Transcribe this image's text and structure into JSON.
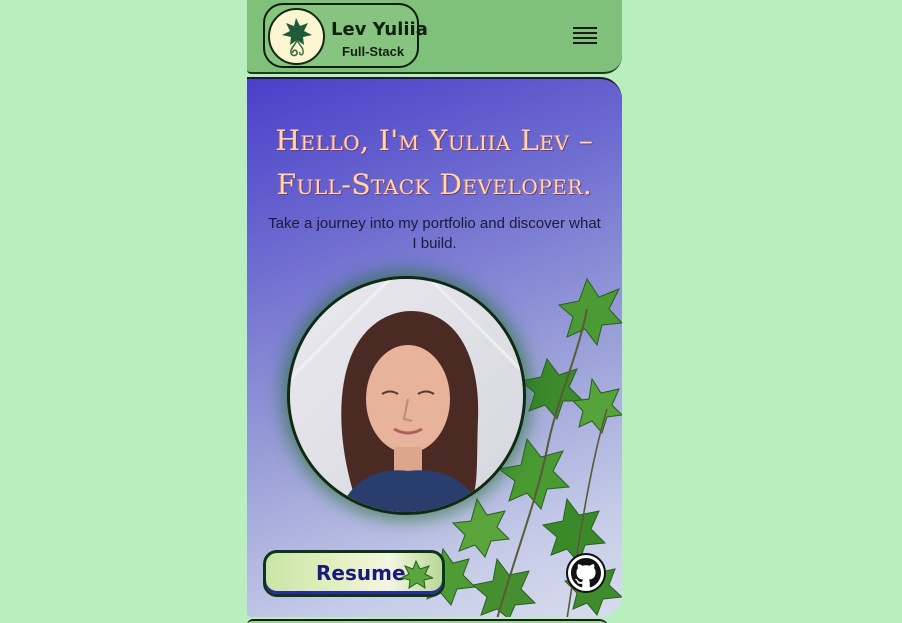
{
  "header": {
    "brand_name": "Lev Yuliia",
    "brand_role": "Full-Stack",
    "logo_icon": "ivy-leaf-icon",
    "menu_icon": "hamburger-menu-icon",
    "background_color": "#7fc07a"
  },
  "hero": {
    "title": "Hello, I'm Yuliia Lev –\nFull-Stack Developer.",
    "subtitle": "Take a journey into my portfolio and discover what I build.",
    "portrait_alt": "Portrait of Yuliia Lev",
    "resume_label": "Resume",
    "github_icon": "github-icon",
    "title_color": "#ffd7a8",
    "gradient_start": "#4a3fc9",
    "gradient_end": "#d8dcef"
  },
  "page": {
    "background_color": "#b9efbf"
  }
}
